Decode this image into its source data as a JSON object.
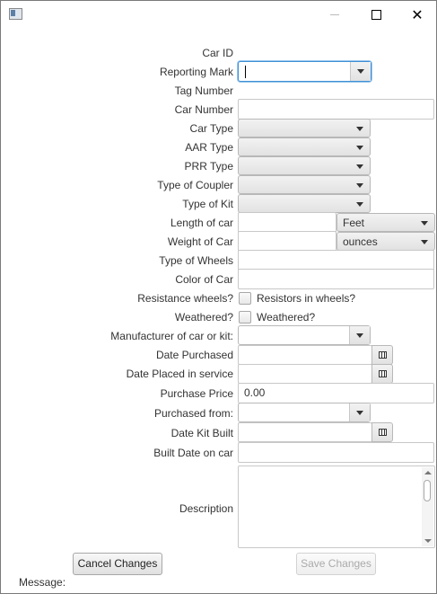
{
  "labels": {
    "car_id": "Car ID",
    "reporting_mark": "Reporting Mark",
    "tag_number": "Tag Number",
    "car_number": "Car Number",
    "car_type": "Car Type",
    "aar_type": "AAR Type",
    "prr_type": "PRR Type",
    "coupler": "Type of Coupler",
    "kit": "Type of Kit",
    "length": "Length of car",
    "weight": "Weight of Car",
    "wheels": "Type of Wheels",
    "color": "Color of Car",
    "resistance": "Resistance wheels?",
    "weathered": "Weathered?",
    "manufacturer": "Manufacturer of car or kit:",
    "date_purchased": "Date Purchased",
    "date_service": "Date Placed in service",
    "price": "Purchase Price",
    "purchased_from": "Purchased from:",
    "date_kit_built": "Date Kit Built",
    "built_date": "Built Date on car",
    "description": "Description",
    "message": "Message:"
  },
  "values": {
    "length_unit": "Feet",
    "weight_unit": "ounces",
    "price": "0.00",
    "resistance_check": "Resistors in wheels?",
    "weathered_check": "Weathered?"
  },
  "buttons": {
    "cancel": "Cancel Changes",
    "save": "Save Changes"
  },
  "icons": {
    "calendar": "calendar-icon",
    "dropdown": "chevron-down-icon"
  }
}
